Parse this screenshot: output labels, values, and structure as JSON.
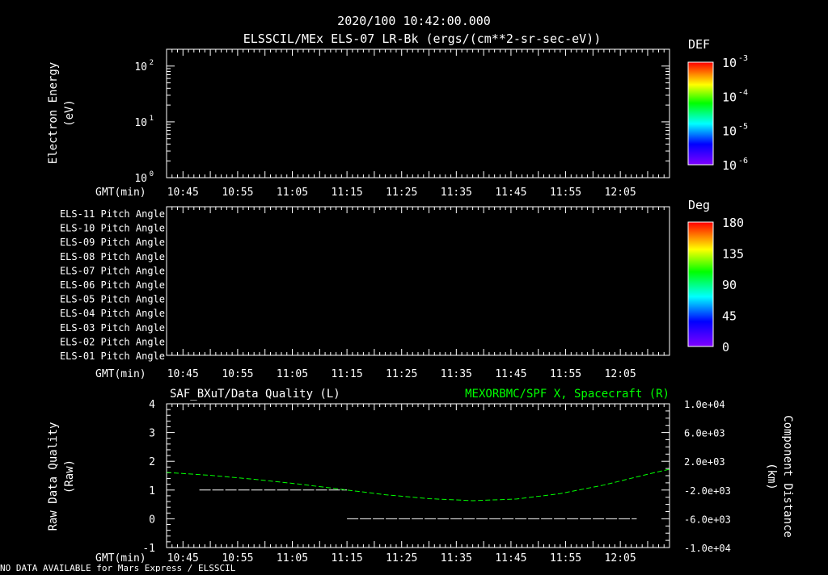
{
  "title": "2020/100 10:42:00.000",
  "subtitle": "ELSSCIL/MEx ELS-07 LR-Bk  (ergs/(cm**2-sr-sec-eV))",
  "footer": "NO DATA AVAILABLE for Mars Express / ELSSCIL",
  "colors": {
    "background": "#000000",
    "axes": "#ffffff",
    "quality": "#ffffff",
    "spacecraft_x": "#00ff00"
  },
  "chart_data": [
    {
      "type": "heatmap",
      "ylabel": "Electron Energy (eV)",
      "ylabel_lines": [
        "Electron Energy",
        "(eV)"
      ],
      "yscale": "log",
      "ylim": [
        1,
        200
      ],
      "yticks": [
        {
          "label": "10",
          "exp": "0"
        },
        {
          "label": "10",
          "exp": "1"
        },
        {
          "label": "10",
          "exp": "2"
        }
      ],
      "xlabel": "GMT(min)",
      "xticks": [
        "10:45",
        "10:55",
        "11:05",
        "11:15",
        "11:25",
        "11:35",
        "11:45",
        "11:55",
        "12:05"
      ],
      "xlim": [
        "10:42",
        "12:14"
      ],
      "colorbar": {
        "title": "DEF",
        "scale": "log",
        "range": [
          1e-06,
          0.001
        ],
        "ticks": [
          {
            "label": "10",
            "exp": "-3"
          },
          {
            "label": "10",
            "exp": "-4"
          },
          {
            "label": "10",
            "exp": "-5"
          },
          {
            "label": "10",
            "exp": "-6"
          }
        ]
      },
      "values": []
    },
    {
      "type": "heatmap",
      "ylabels": [
        "ELS-11 Pitch Angle",
        "ELS-10 Pitch Angle",
        "ELS-09 Pitch Angle",
        "ELS-08 Pitch Angle",
        "ELS-07 Pitch Angle",
        "ELS-06 Pitch Angle",
        "ELS-05 Pitch Angle",
        "ELS-04 Pitch Angle",
        "ELS-03 Pitch Angle",
        "ELS-02 Pitch Angle",
        "ELS-01 Pitch Angle"
      ],
      "xlabel": "GMT(min)",
      "xticks": [
        "10:45",
        "10:55",
        "11:05",
        "11:15",
        "11:25",
        "11:35",
        "11:45",
        "11:55",
        "12:05"
      ],
      "xlim": [
        "10:42",
        "12:14"
      ],
      "colorbar": {
        "title": "Deg",
        "range": [
          0,
          180
        ],
        "ticks": [
          "180",
          "135",
          "90",
          "45",
          "0"
        ]
      },
      "values": []
    },
    {
      "type": "line",
      "title_left": "SAF_BXuT/Data Quality (L)",
      "title_right": "MEXORBMC/SPF X, Spacecraft (R)",
      "ylabel_lines": [
        "Raw Data Quality",
        "(Raw)"
      ],
      "ylabel_right_lines": [
        "Component Distance",
        "(km)"
      ],
      "ylim": [
        -1,
        4
      ],
      "yticks": [
        "4",
        "3",
        "2",
        "1",
        "0",
        "-1"
      ],
      "ylim_right": [
        -10000,
        10000
      ],
      "yticks_right": [
        "1.0e+04",
        "6.0e+03",
        "2.0e+03",
        "-2.0e+03",
        "-6.0e+03",
        "-1.0e+04"
      ],
      "xlabel": "GMT(min)",
      "xticks": [
        "10:45",
        "10:55",
        "11:05",
        "11:15",
        "11:25",
        "11:35",
        "11:45",
        "11:55",
        "12:05"
      ],
      "xlim": [
        "10:42",
        "12:14"
      ],
      "series": [
        {
          "name": "SAF_BXuT/Data Quality",
          "axis": "left",
          "color": "#ffffff",
          "segments": [
            {
              "x": [
                "10:48",
                "11:15"
              ],
              "y": [
                1,
                1
              ]
            },
            {
              "x": [
                "11:15",
                "12:08"
              ],
              "y": [
                0,
                0
              ]
            }
          ]
        },
        {
          "name": "MEXORBMC/SPF X, Spacecraft",
          "axis": "right",
          "color": "#00ff00",
          "style": "dashed",
          "x": [
            "10:42",
            "10:50",
            "10:58",
            "11:06",
            "11:14",
            "11:22",
            "11:30",
            "11:38",
            "11:46",
            "11:54",
            "12:02",
            "12:10",
            "12:14"
          ],
          "y": [
            450,
            50,
            -500,
            -1150,
            -1900,
            -2650,
            -3200,
            -3480,
            -3250,
            -2500,
            -1300,
            200,
            900
          ]
        }
      ]
    }
  ]
}
